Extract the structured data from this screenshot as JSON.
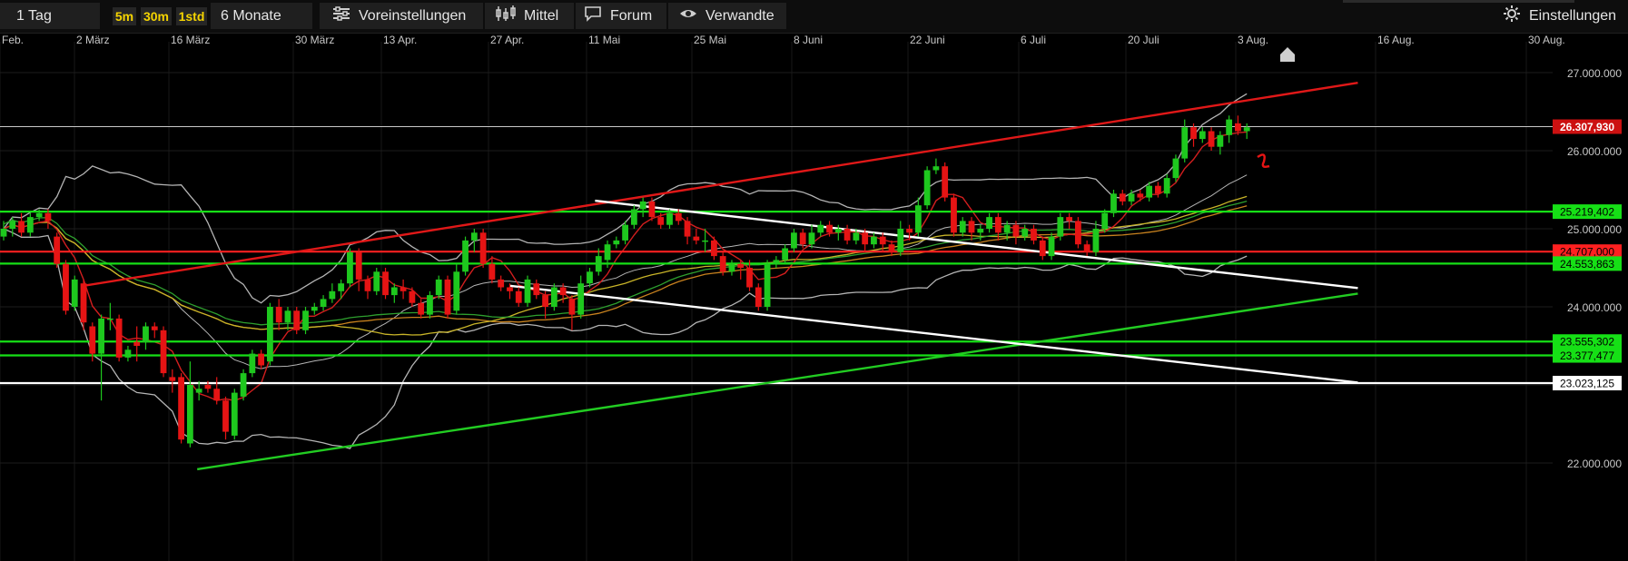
{
  "toolbar": {
    "period": "1 Tag",
    "res_5m": "5m",
    "res_30m": "30m",
    "res_1std": "1std",
    "range": "6 Monate",
    "presets": "Voreinstellungen",
    "average": "Mittel",
    "forum": "Forum",
    "related": "Verwandte",
    "settings": "Einstellungen"
  },
  "icons": {
    "presets": "sliders-icon",
    "average": "candlestick-icon",
    "forum": "chat-bubble-icon",
    "related": "eye-icon",
    "settings": "gear-icon",
    "scroll": "home-marker-icon"
  },
  "colors": {
    "up": "#1ec81e",
    "down": "#e61414",
    "resistance_trend": "#e01818",
    "support_trend": "#22cc22",
    "channel": "#ffffff",
    "bollinger": "#b4b4b4",
    "ma_short": "#d21e1e",
    "ma_mid": "#c8b428",
    "ma_long": "#c8821e",
    "ma_green": "#2ea02e"
  },
  "chart_data": {
    "type": "candlestick",
    "x_tick_labels": [
      "Feb.",
      "2 März",
      "16 März",
      "30 März",
      "13 Apr.",
      "27 Apr.",
      "11 Mai",
      "25 Mai",
      "8 Juni",
      "22 Juni",
      "6 Juli",
      "20 Juli",
      "3 Aug.",
      "16 Aug.",
      "30 Aug."
    ],
    "y_tick_labels": [
      "27.000.000",
      "26.000.000",
      "25.000.000",
      "24.000.000",
      "23.000.000",
      "22.000.000"
    ],
    "ylim": [
      21800000,
      27050000
    ],
    "grid": true,
    "price_levels": [
      {
        "label": "26.307,930",
        "value": 26307930,
        "color": "#c8c8c8",
        "badge": "#cc1111",
        "text_color": "#ffffff"
      },
      {
        "label": "25.219,402",
        "value": 25219402,
        "color": "#16e016",
        "badge": "#16e016",
        "text_color": "#000000"
      },
      {
        "label": "24.707,000",
        "value": 24707000,
        "color": "#ff2020",
        "badge": "#ff2020",
        "text_color": "#000000"
      },
      {
        "label": "24.553,863",
        "value": 24553863,
        "color": "#16e016",
        "badge": "#16e016",
        "text_color": "#000000"
      },
      {
        "label": "23.555,302",
        "value": 23555302,
        "color": "#16e016",
        "badge": "#16e016",
        "text_color": "#000000"
      },
      {
        "label": "23.377,477",
        "value": 23377477,
        "color": "#16e016",
        "badge": "#16e016",
        "text_color": "#000000"
      },
      {
        "label": "23.023,125",
        "value": 23023125,
        "color": "#ffffff",
        "badge": "#ffffff",
        "text_color": "#000000"
      }
    ],
    "candles": [
      [
        24900000,
        25000000,
        24850000,
        25100000
      ],
      [
        25000000,
        25100000,
        24900000,
        25150000
      ],
      [
        25100000,
        24950000,
        24900000,
        25200000
      ],
      [
        24950000,
        25150000,
        24900000,
        25200000
      ],
      [
        25150000,
        25200000,
        25100000,
        25250000
      ],
      [
        25200000,
        25100000,
        25000000,
        25250000
      ],
      [
        24900000,
        24550000,
        24500000,
        24950000
      ],
      [
        24550000,
        23950000,
        23900000,
        24600000
      ],
      [
        24000000,
        24350000,
        23950000,
        24400000
      ],
      [
        24300000,
        23800000,
        23700000,
        24350000
      ],
      [
        23750000,
        23400000,
        23300000,
        23800000
      ],
      [
        23400000,
        23850000,
        22800000,
        23900000
      ],
      [
        23850000,
        23850000,
        23700000,
        24050000
      ],
      [
        23850000,
        23350000,
        23300000,
        23900000
      ],
      [
        23350000,
        23450000,
        23300000,
        23500000
      ],
      [
        23550000,
        23500000,
        23300000,
        23750000
      ],
      [
        23550000,
        23750000,
        23450000,
        23800000
      ],
      [
        23750000,
        23700000,
        23600000,
        23800000
      ],
      [
        23700000,
        23150000,
        23100000,
        23750000
      ],
      [
        23100000,
        23050000,
        22900000,
        23200000
      ],
      [
        23100000,
        22300000,
        22250000,
        23150000
      ],
      [
        22250000,
        23000000,
        22200000,
        23300000
      ],
      [
        22900000,
        22950000,
        22800000,
        23050000
      ],
      [
        23000000,
        22950000,
        22900000,
        23050000
      ],
      [
        22950000,
        22800000,
        22750000,
        23100000
      ],
      [
        22800000,
        22400000,
        22300000,
        22850000
      ],
      [
        22350000,
        22900000,
        22300000,
        22950000
      ],
      [
        22850000,
        23150000,
        22800000,
        23200000
      ],
      [
        23150000,
        23400000,
        23100000,
        23450000
      ],
      [
        23400000,
        23250000,
        23200000,
        23450000
      ],
      [
        23300000,
        24000000,
        23250000,
        24050000
      ],
      [
        24000000,
        23800000,
        23700000,
        24100000
      ],
      [
        23800000,
        23950000,
        23700000,
        24000000
      ],
      [
        23950000,
        23700000,
        23650000,
        24000000
      ],
      [
        23700000,
        23950000,
        23650000,
        24000000
      ],
      [
        23950000,
        24000000,
        23900000,
        24050000
      ],
      [
        24000000,
        24100000,
        23950000,
        24150000
      ],
      [
        24100000,
        24200000,
        24050000,
        24300000
      ],
      [
        24200000,
        24300000,
        24100000,
        24350000
      ],
      [
        24300000,
        24700000,
        24250000,
        24750000
      ],
      [
        24700000,
        24350000,
        24200000,
        24750000
      ],
      [
        24350000,
        24200000,
        24100000,
        24400000
      ],
      [
        24200000,
        24450000,
        24150000,
        24500000
      ],
      [
        24450000,
        24150000,
        24100000,
        24500000
      ],
      [
        24150000,
        24250000,
        24050000,
        24300000
      ],
      [
        24250000,
        24200000,
        24100000,
        24350000
      ],
      [
        24200000,
        24050000,
        24000000,
        24250000
      ],
      [
        24050000,
        23900000,
        23850000,
        24100000
      ],
      [
        23900000,
        24150000,
        23850000,
        24200000
      ],
      [
        24150000,
        24350000,
        24100000,
        24400000
      ],
      [
        24350000,
        23900000,
        23850000,
        24400000
      ],
      [
        23950000,
        24450000,
        23900000,
        24550000
      ],
      [
        24450000,
        24850000,
        24400000,
        24900000
      ],
      [
        24850000,
        24950000,
        24700000,
        25000000
      ],
      [
        24950000,
        24550000,
        24500000,
        25000000
      ],
      [
        24550000,
        24350000,
        24300000,
        24650000
      ],
      [
        24350000,
        24250000,
        24200000,
        24400000
      ],
      [
        24250000,
        24200000,
        24100000,
        24300000
      ],
      [
        24200000,
        24050000,
        24000000,
        24250000
      ],
      [
        24050000,
        24350000,
        24000000,
        24400000
      ],
      [
        24300000,
        24150000,
        24100000,
        24350000
      ],
      [
        24150000,
        24000000,
        23850000,
        24200000
      ],
      [
        24000000,
        24250000,
        23950000,
        24300000
      ],
      [
        24250000,
        24150000,
        24050000,
        24300000
      ],
      [
        24100000,
        23900000,
        23700000,
        24150000
      ],
      [
        23900000,
        24300000,
        23850000,
        24400000
      ],
      [
        24300000,
        24450000,
        24250000,
        24500000
      ],
      [
        24450000,
        24650000,
        24400000,
        24750000
      ],
      [
        24600000,
        24800000,
        24500000,
        24850000
      ],
      [
        24800000,
        24850000,
        24750000,
        24900000
      ],
      [
        24850000,
        25050000,
        24800000,
        25100000
      ],
      [
        25050000,
        25250000,
        25000000,
        25300000
      ],
      [
        25250000,
        25350000,
        25150000,
        25400000
      ],
      [
        25350000,
        25150000,
        25100000,
        25400000
      ],
      [
        25150000,
        25050000,
        25000000,
        25200000
      ],
      [
        25050000,
        25200000,
        25000000,
        25250000
      ],
      [
        25200000,
        25100000,
        25050000,
        25250000
      ],
      [
        25100000,
        24900000,
        24800000,
        25150000
      ],
      [
        24900000,
        24850000,
        24800000,
        25000000
      ],
      [
        24850000,
        24850000,
        24700000,
        25000000
      ],
      [
        24850000,
        24650000,
        24600000,
        24900000
      ],
      [
        24650000,
        24450000,
        24400000,
        24700000
      ],
      [
        24450000,
        24550000,
        24400000,
        24600000
      ],
      [
        24550000,
        24500000,
        24350000,
        24600000
      ],
      [
        24500000,
        24250000,
        24200000,
        24600000
      ],
      [
        24250000,
        24000000,
        23950000,
        24300000
      ],
      [
        24000000,
        24550000,
        23950000,
        24600000
      ],
      [
        24550000,
        24600000,
        24500000,
        24650000
      ],
      [
        24600000,
        24750000,
        24550000,
        24800000
      ],
      [
        24750000,
        24950000,
        24700000,
        25000000
      ],
      [
        24950000,
        24800000,
        24750000,
        25000000
      ],
      [
        24800000,
        24950000,
        24750000,
        25050000
      ],
      [
        24950000,
        25050000,
        24900000,
        25100000
      ],
      [
        25050000,
        24950000,
        24900000,
        25100000
      ],
      [
        24950000,
        25000000,
        24850000,
        25050000
      ],
      [
        25000000,
        24850000,
        24800000,
        25050000
      ],
      [
        24850000,
        24950000,
        24800000,
        25000000
      ],
      [
        24950000,
        24800000,
        24700000,
        25000000
      ],
      [
        24800000,
        24900000,
        24750000,
        24950000
      ],
      [
        24900000,
        24800000,
        24700000,
        24950000
      ],
      [
        24800000,
        24700000,
        24650000,
        24850000
      ],
      [
        24700000,
        25000000,
        24650000,
        25100000
      ],
      [
        25000000,
        24950000,
        24850000,
        25050000
      ],
      [
        24950000,
        25300000,
        24900000,
        25400000
      ],
      [
        25300000,
        25750000,
        25250000,
        25800000
      ],
      [
        25750000,
        25800000,
        25700000,
        25900000
      ],
      [
        25800000,
        25400000,
        25350000,
        25850000
      ],
      [
        25400000,
        24950000,
        24900000,
        25450000
      ],
      [
        24950000,
        25100000,
        24900000,
        25150000
      ],
      [
        25100000,
        24950000,
        24850000,
        25150000
      ],
      [
        24950000,
        25000000,
        24850000,
        25050000
      ],
      [
        25000000,
        25150000,
        24950000,
        25200000
      ],
      [
        25150000,
        24950000,
        24850000,
        25200000
      ],
      [
        24950000,
        25050000,
        24850000,
        25100000
      ],
      [
        25050000,
        24900000,
        24800000,
        25100000
      ],
      [
        24900000,
        25000000,
        24850000,
        25050000
      ],
      [
        25000000,
        24850000,
        24800000,
        25050000
      ],
      [
        24850000,
        24650000,
        24600000,
        24900000
      ],
      [
        24650000,
        24900000,
        24600000,
        24950000
      ],
      [
        24900000,
        25150000,
        24850000,
        25200000
      ],
      [
        25150000,
        25100000,
        25000000,
        25200000
      ],
      [
        25100000,
        24800000,
        24750000,
        25150000
      ],
      [
        24800000,
        24700000,
        24650000,
        24850000
      ],
      [
        24700000,
        25000000,
        24650000,
        25100000
      ],
      [
        25000000,
        25200000,
        24950000,
        25250000
      ],
      [
        25200000,
        25450000,
        25150000,
        25500000
      ],
      [
        25450000,
        25350000,
        25300000,
        25500000
      ],
      [
        25350000,
        25450000,
        25300000,
        25500000
      ],
      [
        25450000,
        25400000,
        25350000,
        25500000
      ],
      [
        25400000,
        25550000,
        25350000,
        25600000
      ],
      [
        25550000,
        25450000,
        25400000,
        25600000
      ],
      [
        25450000,
        25650000,
        25400000,
        25700000
      ],
      [
        25650000,
        25900000,
        25600000,
        25950000
      ],
      [
        25900000,
        26300000,
        25850000,
        26400000
      ],
      [
        26300000,
        26150000,
        26050000,
        26350000
      ],
      [
        26150000,
        26250000,
        26100000,
        26300000
      ],
      [
        26250000,
        26050000,
        26000000,
        26300000
      ],
      [
        26050000,
        26200000,
        25950000,
        26250000
      ],
      [
        26200000,
        26400000,
        26100000,
        26450000
      ],
      [
        26350000,
        26250000,
        26200000,
        26450000
      ],
      [
        26250000,
        26300000,
        26150000,
        26350000
      ]
    ]
  }
}
